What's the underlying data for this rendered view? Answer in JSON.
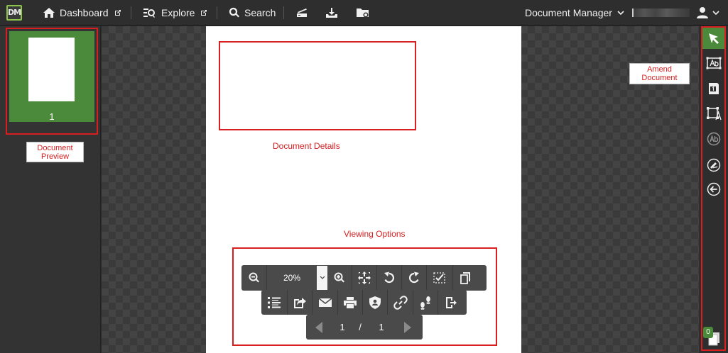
{
  "app": {
    "logo_text": "DM"
  },
  "nav": {
    "dashboard": "Dashboard",
    "explore": "Explore",
    "search": "Search",
    "document_manager": "Document Manager"
  },
  "thumbnail": {
    "page_number": "1"
  },
  "annotations": {
    "document_preview": "Document Preview",
    "document_details": "Document Details",
    "viewing_options": "Viewing Options",
    "amend_document": "Amend Document"
  },
  "viewer": {
    "zoom": "20%",
    "current_page": "1",
    "page_separator": "/",
    "total_pages": "1"
  },
  "right_tools": {
    "selected_count": "0"
  },
  "colors": {
    "accent_green": "#4a8a3a",
    "annotation_red": "#d81e1e",
    "toolbar_bg": "#2e2e2e"
  }
}
